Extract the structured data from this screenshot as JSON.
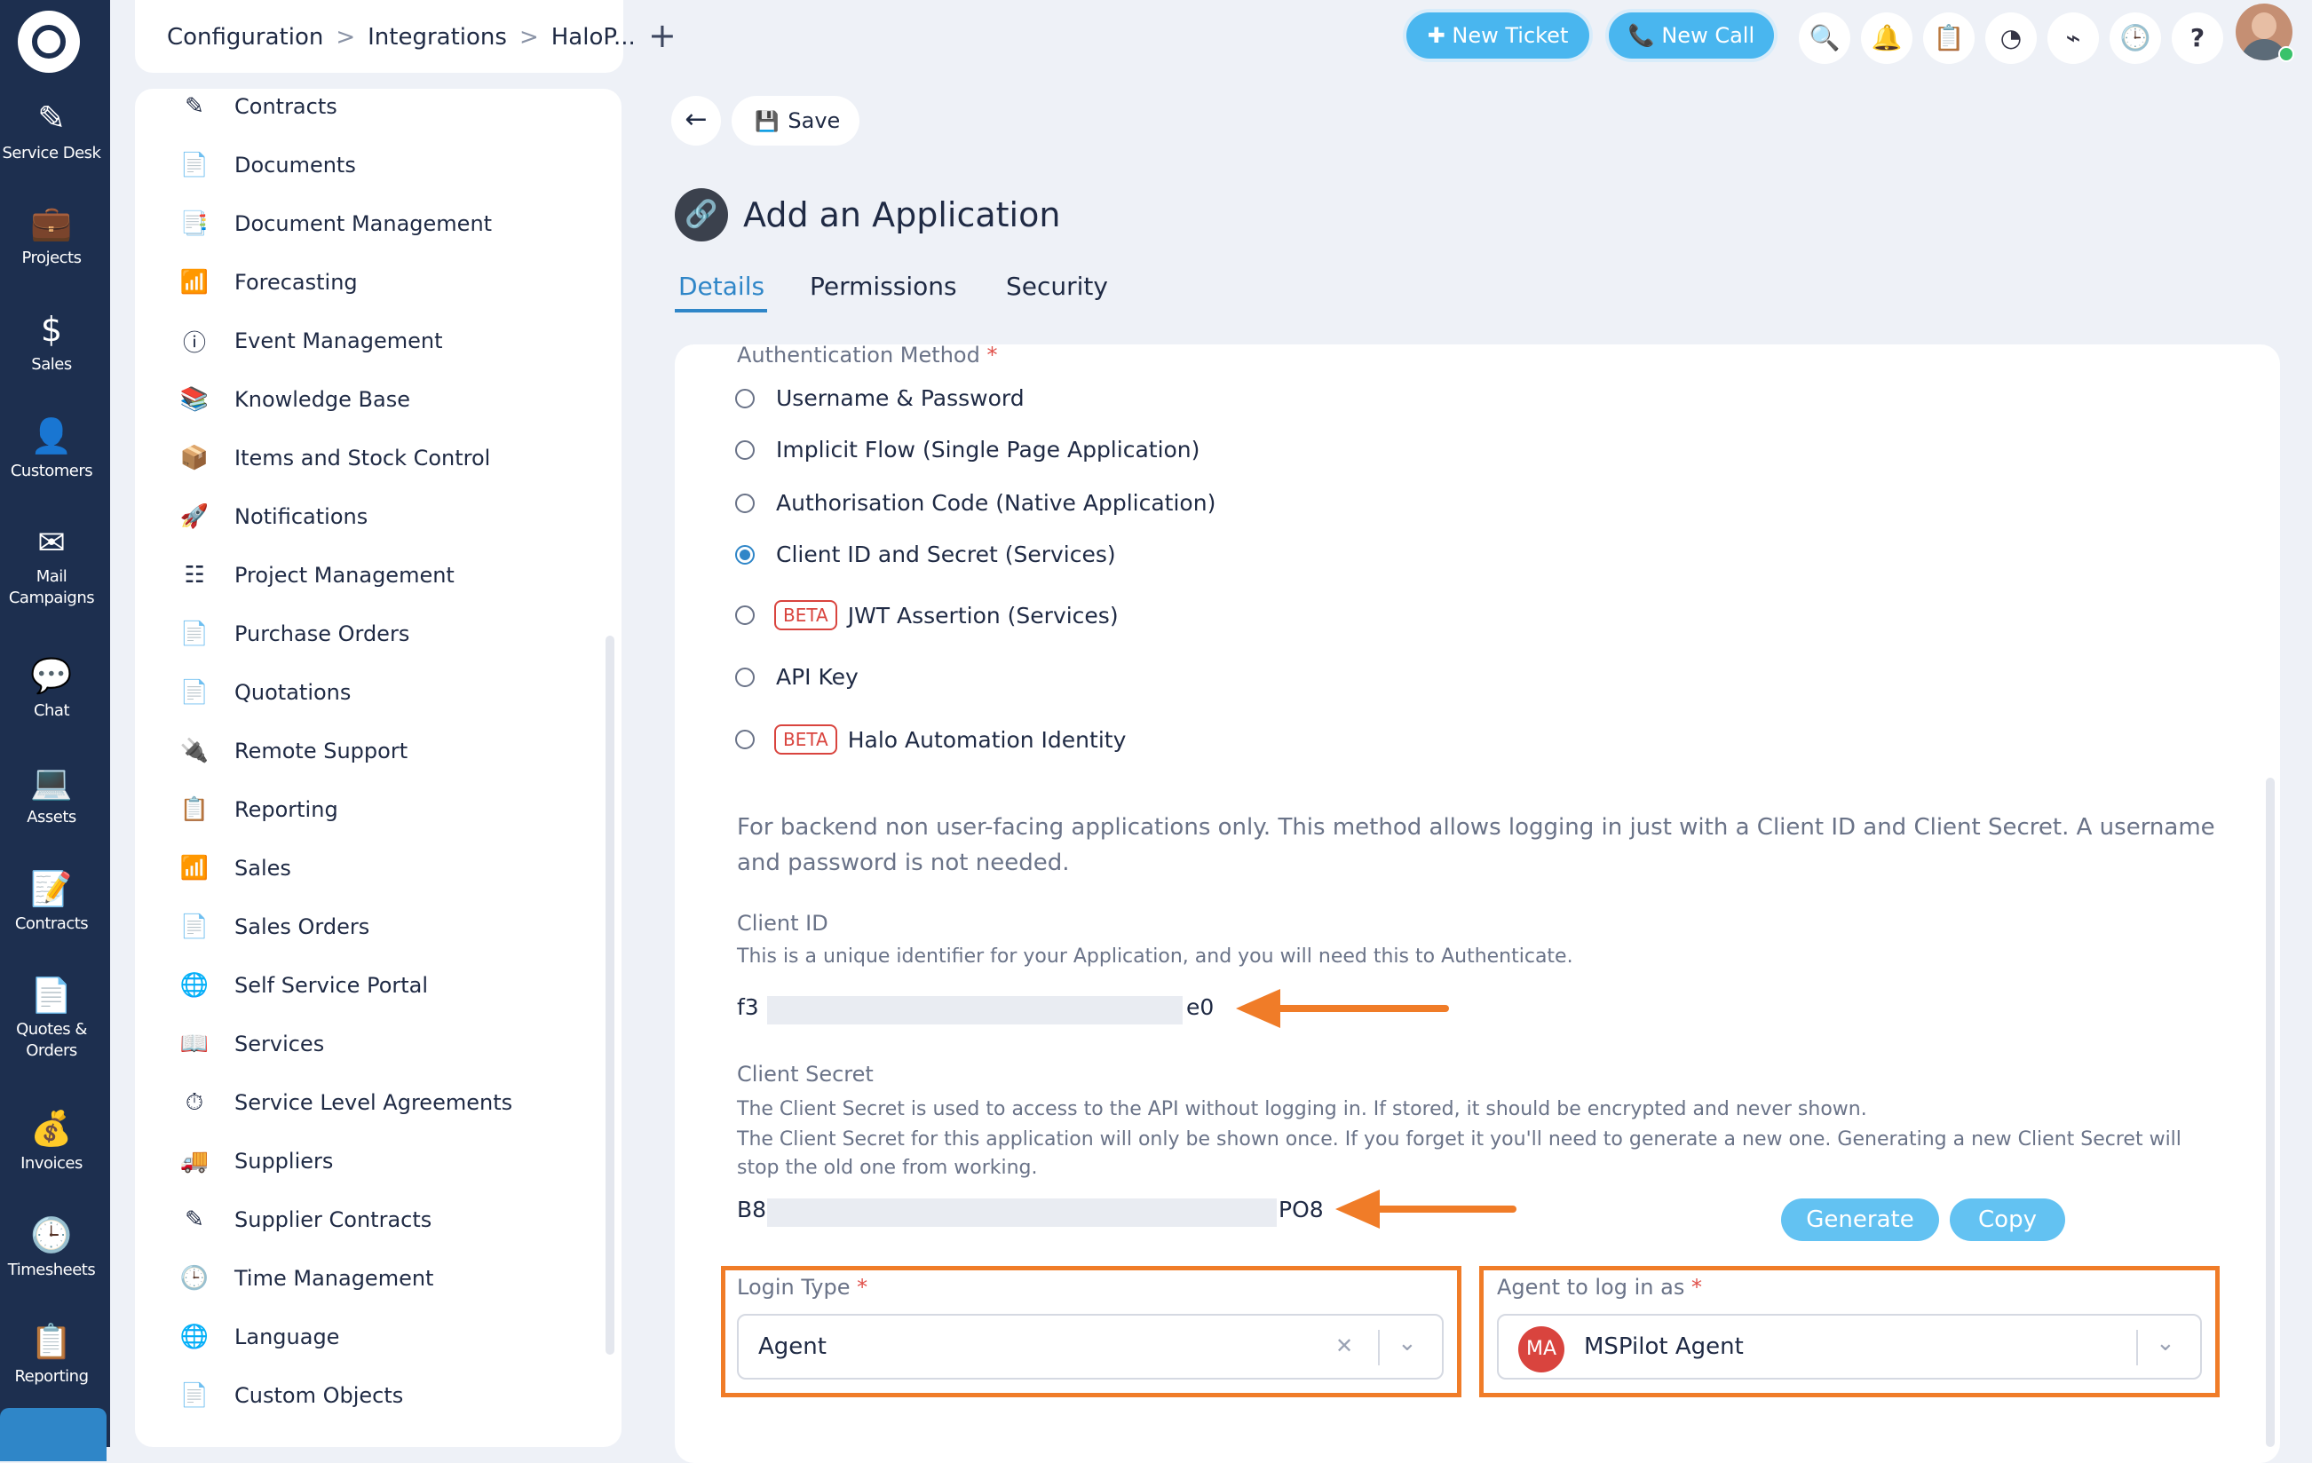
{
  "leftnav": {
    "items": [
      {
        "label": "Service Desk",
        "icon": "ticket-icon",
        "glyph": "✎"
      },
      {
        "label": "Projects",
        "icon": "briefcase-icon",
        "glyph": "💼"
      },
      {
        "label": "Sales",
        "icon": "dollar-icon",
        "glyph": "$"
      },
      {
        "label": "Customers",
        "icon": "person-icon",
        "glyph": "👤"
      },
      {
        "label": "Mail Campaigns",
        "icon": "envelope-icon",
        "glyph": "✉"
      },
      {
        "label": "Chat",
        "icon": "chat-icon",
        "glyph": "💬"
      },
      {
        "label": "Assets",
        "icon": "laptop-icon",
        "glyph": "💻"
      },
      {
        "label": "Contracts",
        "icon": "edit-icon",
        "glyph": "📝"
      },
      {
        "label": "Quotes & Orders",
        "icon": "quote-doc-icon",
        "glyph": "📄"
      },
      {
        "label": "Invoices",
        "icon": "money-bag-icon",
        "glyph": "💰"
      },
      {
        "label": "Timesheets",
        "icon": "clock-icon",
        "glyph": "🕒"
      },
      {
        "label": "Reporting",
        "icon": "report-icon",
        "glyph": "📋"
      }
    ]
  },
  "breadcrumb": {
    "items": [
      "Configuration",
      "Integrations",
      "HaloP..."
    ],
    "separator": ">"
  },
  "new_tab": "+",
  "top": {
    "new_ticket": "✚ New Ticket",
    "new_call": "📞 New Call",
    "icons": [
      {
        "name": "search-icon",
        "glyph": "🔍"
      },
      {
        "name": "bell-icon",
        "glyph": "🔔"
      },
      {
        "name": "clipboard-icon",
        "glyph": "📋"
      },
      {
        "name": "dashboard-icon",
        "glyph": "◔"
      },
      {
        "name": "rss-icon",
        "glyph": "⌁"
      },
      {
        "name": "clock-icon",
        "glyph": "🕒"
      },
      {
        "name": "help-icon",
        "glyph": "?"
      }
    ]
  },
  "sidebar": {
    "items": [
      {
        "label": "Contracts",
        "glyph": "✎"
      },
      {
        "label": "Documents",
        "glyph": "📄"
      },
      {
        "label": "Document Management",
        "glyph": "📑"
      },
      {
        "label": "Forecasting",
        "glyph": "📶"
      },
      {
        "label": "Event Management",
        "glyph": "ⓘ"
      },
      {
        "label": "Knowledge Base",
        "glyph": "📚"
      },
      {
        "label": "Items and Stock Control",
        "glyph": "📦"
      },
      {
        "label": "Notifications",
        "glyph": "🚀"
      },
      {
        "label": "Project Management",
        "glyph": "☷"
      },
      {
        "label": "Purchase Orders",
        "glyph": "📄"
      },
      {
        "label": "Quotations",
        "glyph": "📄"
      },
      {
        "label": "Remote Support",
        "glyph": "🔌"
      },
      {
        "label": "Reporting",
        "glyph": "📋"
      },
      {
        "label": "Sales",
        "glyph": "📶"
      },
      {
        "label": "Sales Orders",
        "glyph": "📄"
      },
      {
        "label": "Self Service Portal",
        "glyph": "🌐"
      },
      {
        "label": "Services",
        "glyph": "📖"
      },
      {
        "label": "Service Level Agreements",
        "glyph": "⏱"
      },
      {
        "label": "Suppliers",
        "glyph": "🚚"
      },
      {
        "label": "Supplier Contracts",
        "glyph": "✎"
      },
      {
        "label": "Time Management",
        "glyph": "🕒"
      },
      {
        "label": "Language",
        "glyph": "🌐"
      },
      {
        "label": "Custom Objects",
        "glyph": "📄"
      }
    ]
  },
  "toolbar": {
    "back": "←",
    "save": "Save",
    "save_glyph": "💾"
  },
  "page": {
    "title": "Add an Application",
    "icon_glyph": "🔗"
  },
  "tabs": [
    "Details",
    "Permissions",
    "Security"
  ],
  "auth": {
    "label": "Authentication Method",
    "required": "*",
    "options": [
      {
        "label": "Username & Password",
        "beta": false,
        "checked": false
      },
      {
        "label": "Implicit Flow (Single Page Application)",
        "beta": false,
        "checked": false
      },
      {
        "label": "Authorisation Code (Native Application)",
        "beta": false,
        "checked": false
      },
      {
        "label": "Client ID and Secret (Services)",
        "beta": false,
        "checked": true
      },
      {
        "label": "JWT Assertion (Services)",
        "beta": true,
        "checked": false
      },
      {
        "label": "API Key",
        "beta": false,
        "checked": false
      },
      {
        "label": "Halo Automation Identity",
        "beta": true,
        "checked": false
      }
    ],
    "beta_label": "BETA",
    "description": "For backend non user-facing applications only. This method allows logging in just with a Client ID and Client Secret. A username and password is not needed."
  },
  "client_id": {
    "label": "Client ID",
    "help": "This is a unique identifier for your Application, and you will need this to Authenticate.",
    "prefix": "f3",
    "suffix": "e0"
  },
  "client_secret": {
    "label": "Client Secret",
    "help1": "The Client Secret is used to access to the API without logging in. If stored, it should be encrypted and never shown.",
    "help2": "The Client Secret for this application will only be shown once. If you forget it you'll need to generate a new one. Generating a new Client Secret will stop the old one from working.",
    "prefix": "B8",
    "suffix": "PO8",
    "generate": "Generate",
    "copy": "Copy"
  },
  "login_type": {
    "label": "Login Type",
    "required": "*",
    "value": "Agent",
    "clear": "✕",
    "chevron": "⌄"
  },
  "agent": {
    "label": "Agent to log in as",
    "required": "*",
    "initials": "MA",
    "value": "MSPilot Agent",
    "chevron": "⌄"
  },
  "colors": {
    "accent": "#2f86c8",
    "highlight": "#f07c28",
    "nav": "#1d2f4f",
    "button": "#49b6ef",
    "beta": "#d9443e"
  }
}
